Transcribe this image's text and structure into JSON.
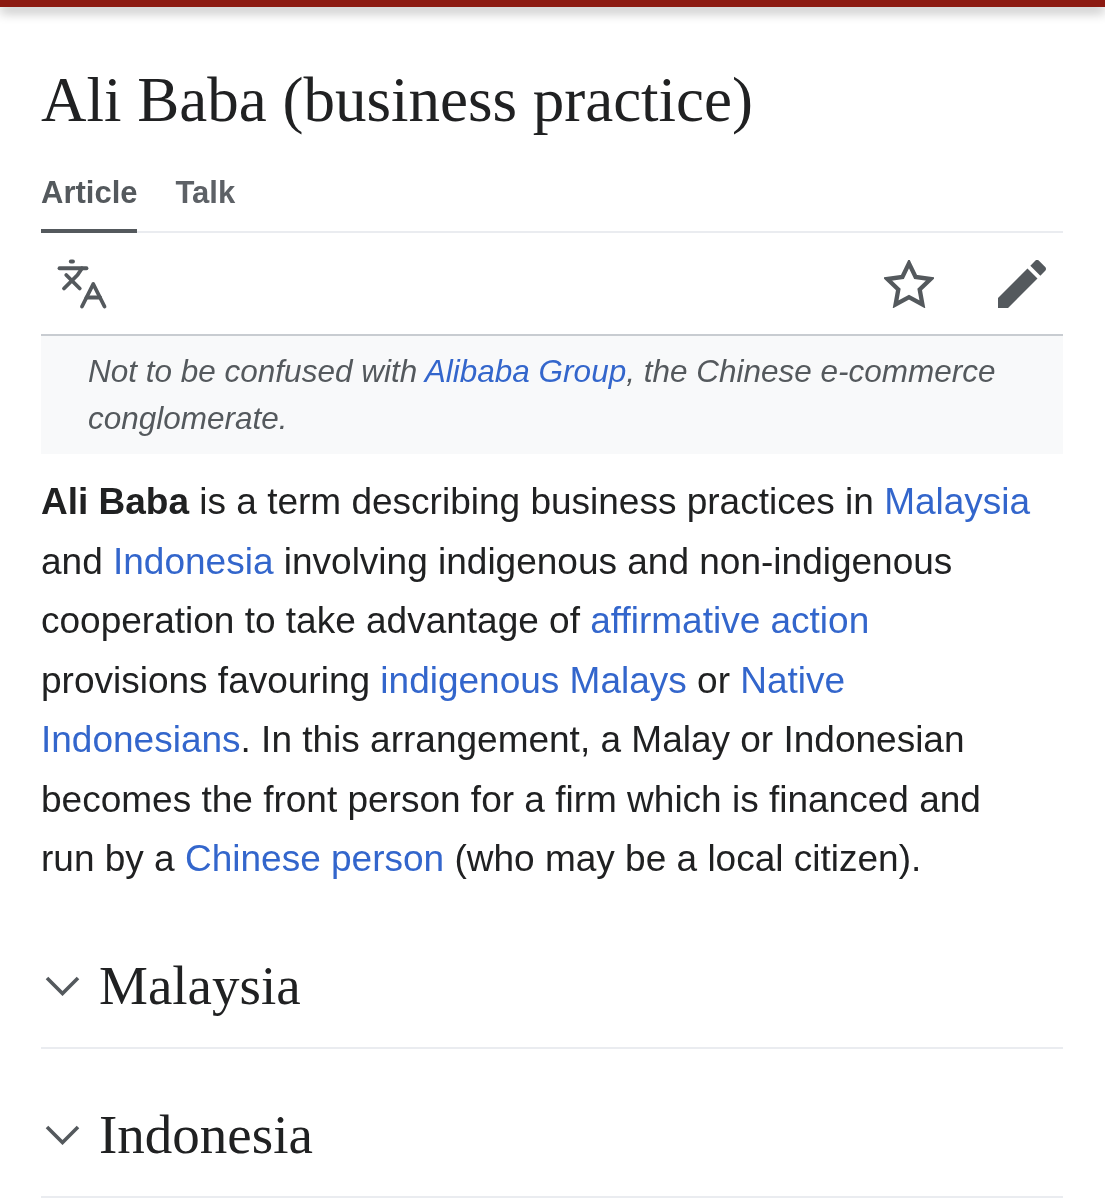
{
  "title": "Ali Baba (business practice)",
  "tabs": [
    {
      "label": "Article",
      "selected": true
    },
    {
      "label": "Talk",
      "selected": false
    }
  ],
  "hatnote": [
    {
      "kind": "text",
      "text": "Not to be confused with "
    },
    {
      "kind": "link",
      "text": "Alibaba Group"
    },
    {
      "kind": "text",
      "text": ", the Chinese e-commerce conglomerate."
    }
  ],
  "paragraph": [
    {
      "kind": "text",
      "text": "**Ali Baba** is a term describing business practices in "
    },
    {
      "kind": "link",
      "text": "Malaysia"
    },
    {
      "kind": "text",
      "text": " and "
    },
    {
      "kind": "link",
      "text": "Indonesia"
    },
    {
      "kind": "text",
      "text": " involving indigenous and non-indigenous cooperation to take advantage of "
    },
    {
      "kind": "link",
      "text": "affirmative action"
    },
    {
      "kind": "text",
      "text": " provisions favouring "
    },
    {
      "kind": "link",
      "text": "indigenous Malays"
    },
    {
      "kind": "text",
      "text": " or "
    },
    {
      "kind": "link",
      "text": "Native "
    },
    {
      "kind": "link",
      "text": "Indonesians"
    },
    {
      "kind": "text",
      "text": ". In this arrangement, a Malay or Indonesian becomes the front person for a firm which is financed and run by a "
    },
    {
      "kind": "link",
      "text": "Chinese person"
    },
    {
      "kind": "text",
      "text": " (who may be a local citizen)."
    }
  ],
  "sections": [
    {
      "title": "Malaysia",
      "expanded": false
    },
    {
      "title": "Indonesia",
      "expanded": false
    }
  ]
}
